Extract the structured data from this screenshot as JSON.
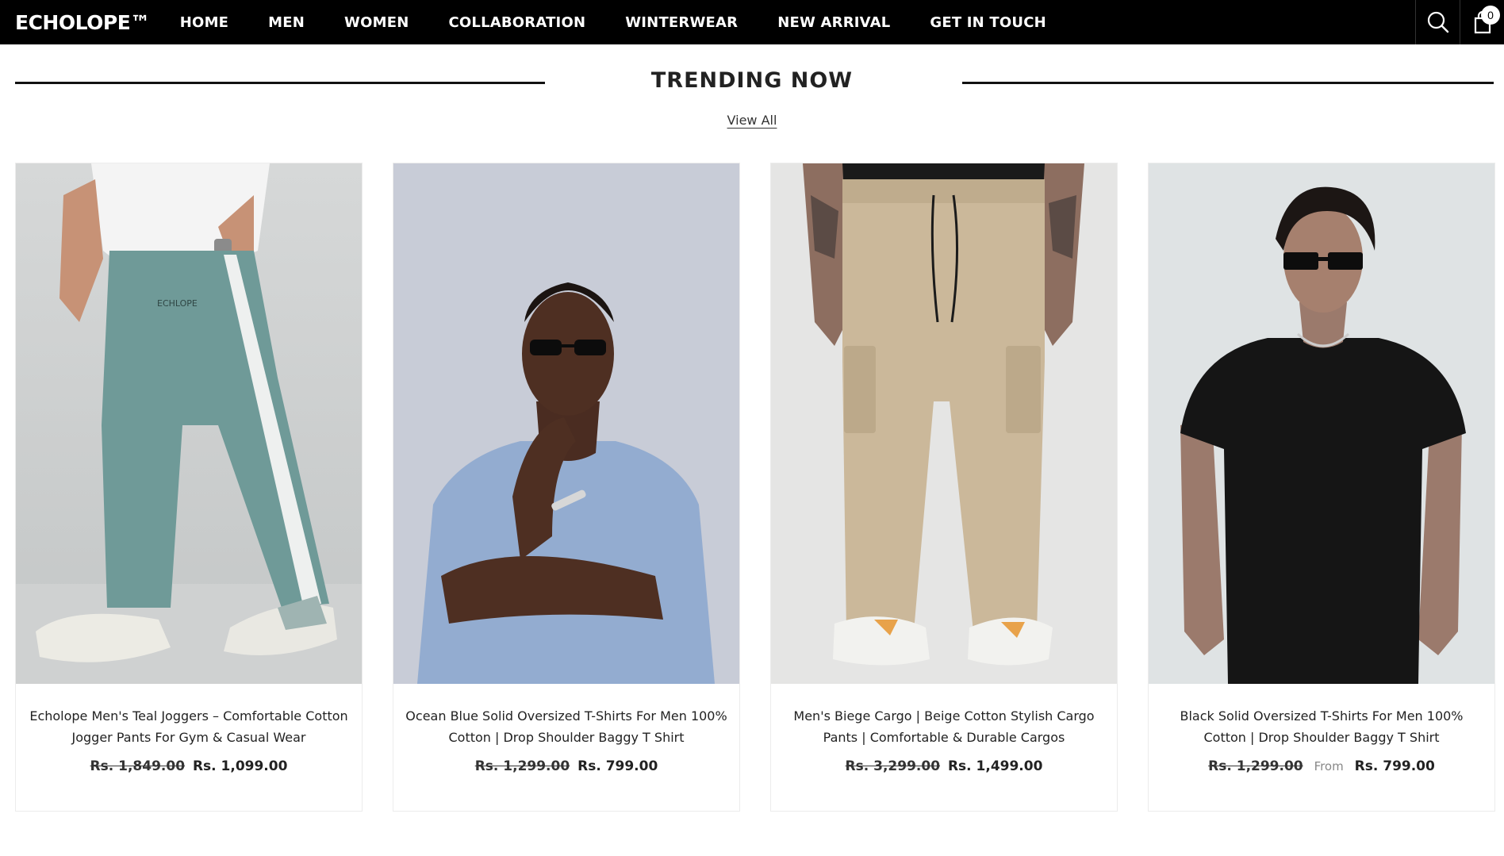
{
  "brand": {
    "logo": "ECHOLOPE™"
  },
  "nav": {
    "items": [
      "HOME",
      "MEN",
      "WOMEN",
      "COLLABORATION",
      "WINTERWEAR",
      "NEW ARRIVAL",
      "GET IN TOUCH"
    ]
  },
  "header": {
    "cart_count": "0",
    "icons": [
      "search-icon",
      "cart-icon"
    ]
  },
  "section": {
    "title": "TRENDING NOW",
    "view_all": "View All"
  },
  "products": [
    {
      "title": "Echolope Men's Teal Joggers – Comfortable Cotton Jogger Pants For Gym & Casual Wear",
      "old_price": "Rs. 1,849.00",
      "from": "",
      "price": "Rs. 1,099.00",
      "image": "model wearing teal joggers with white side stripe"
    },
    {
      "title": "Ocean Blue Solid Oversized T-Shirts For Men 100% Cotton | Drop Shoulder Baggy T Shirt",
      "old_price": "Rs. 1,299.00",
      "from": "",
      "price": "Rs. 799.00",
      "image": "model in ocean blue oversized t-shirt with sunglasses"
    },
    {
      "title": "Men's Biege Cargo | Beige Cotton Stylish Cargo Pants | Comfortable & Durable Cargos",
      "old_price": "Rs. 3,299.00",
      "from": "",
      "price": "Rs. 1,499.00",
      "image": "model in beige cargo pants with sneakers"
    },
    {
      "title": "Black Solid Oversized T-Shirts For Men 100% Cotton | Drop Shoulder Baggy T Shirt",
      "old_price": "Rs. 1,299.00",
      "from": "From",
      "price": "Rs. 799.00",
      "image": "model in black oversized t-shirt with sunglasses"
    }
  ],
  "colors": {
    "header_bg": "#000000",
    "teal": "#6f9a98",
    "ocean_blue": "#93acd0",
    "beige": "#cbb89a",
    "black_tee": "#151515"
  }
}
